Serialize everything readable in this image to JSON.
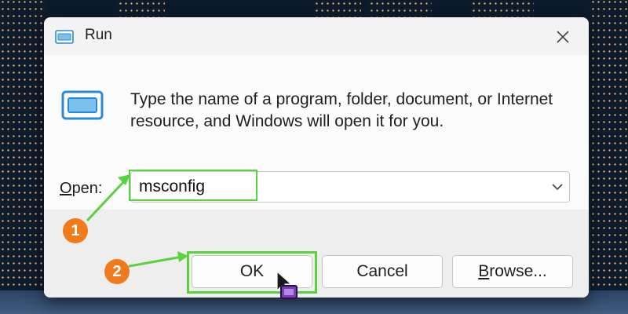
{
  "dialog": {
    "title": "Run",
    "description": "Type the name of a program, folder, document, or Internet resource, and Windows will open it for you.",
    "open_label_mnemonic": "O",
    "open_label_rest": "pen:",
    "open_value": "msconfig"
  },
  "buttons": {
    "ok": "OK",
    "cancel": "Cancel",
    "browse_mnemonic": "B",
    "browse_rest": "rowse..."
  },
  "annotations": {
    "step1": "1",
    "step2": "2"
  },
  "colors": {
    "highlight": "#5ad23d",
    "badge": "#f07b1c",
    "run_icon": "#2a8ad6"
  },
  "icons": [
    "run-icon",
    "close-icon",
    "chevron-down-icon",
    "cursor-icon"
  ]
}
